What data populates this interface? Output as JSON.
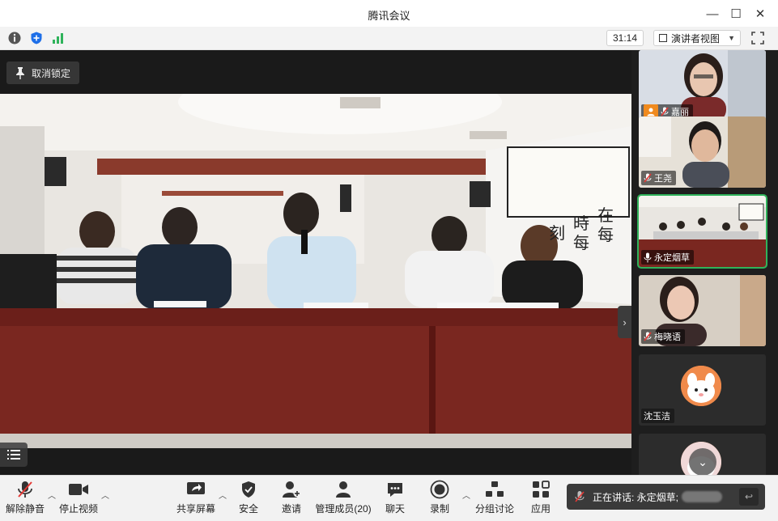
{
  "window": {
    "title": "腾讯会议",
    "minimize_glyph": "—",
    "maximize_glyph": "☐",
    "close_glyph": "✕"
  },
  "toolbar": {
    "icons": [
      "info-icon",
      "shield-icon",
      "signal-icon"
    ],
    "timer": "31:14",
    "view_mode": "演讲者视图"
  },
  "stage": {
    "unpin_label": "取消锁定",
    "calligraphy": [
      "在",
      "時",
      "每",
      "刻",
      "每"
    ]
  },
  "participants": [
    {
      "name": "嘉丽",
      "muted": true,
      "host": true
    },
    {
      "name": "王尧",
      "muted": true
    },
    {
      "name": "永定烟草",
      "muted": false,
      "active_speaker": true
    },
    {
      "name": "梅晓语",
      "muted": true
    },
    {
      "name": "沈玉洁",
      "avatar": "cartoon-avatar"
    },
    {
      "name": "",
      "avatar": "cartoon-avatar"
    }
  ],
  "bottom_bar": {
    "unmute": "解除静音",
    "stop_video": "停止视频",
    "share_screen": "共享屏幕",
    "security": "安全",
    "invite": "邀请",
    "manage_members": "管理成员(20)",
    "chat": "聊天",
    "record": "录制",
    "breakout": "分组讨论",
    "apps": "应用"
  },
  "speaking": {
    "label": "正在讲话: 永定烟草;"
  },
  "colors": {
    "active_speaker_border": "#2fb35b",
    "host_badge": "#f08a1e",
    "muted_mic": "#e53935"
  }
}
